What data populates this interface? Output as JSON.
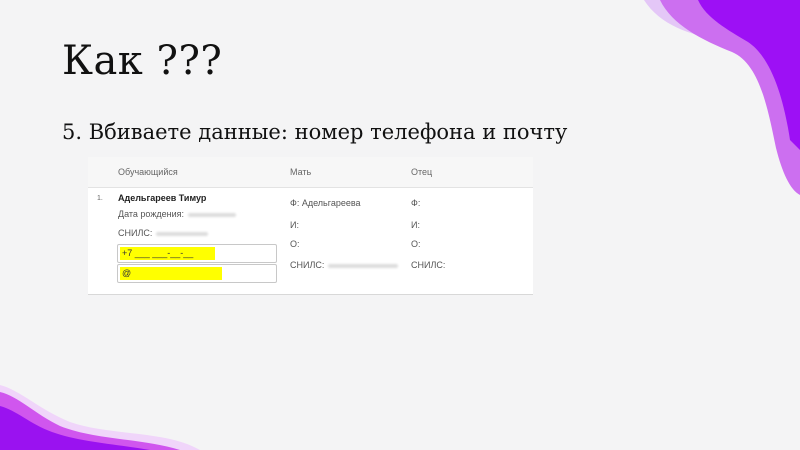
{
  "slide": {
    "title": "Как ???",
    "subtitle": "5. Вбиваете данные: номер телефона и почту"
  },
  "table": {
    "headers": {
      "student": "Обучающийся",
      "mother": "Мать",
      "father": "Отец"
    },
    "row": {
      "number": "1.",
      "student": {
        "name": "Адельгареев Тимур",
        "birth_label": "Дата рождения:",
        "snils_label": "СНИЛС:",
        "phone_value": "+7 ___ ___-__-__",
        "email_value": "@"
      },
      "mother": {
        "f_label": "Ф: Адельгареева",
        "i_label": "И:",
        "o_label": "О:",
        "snils_label": "СНИЛС:"
      },
      "father": {
        "f_label": "Ф:",
        "i_label": "И:",
        "o_label": "О:",
        "snils_label": "СНИЛС:"
      }
    }
  },
  "colors": {
    "highlight": "#ffff00",
    "accent_purple": "#a100ff",
    "accent_magenta": "#d81cf0"
  }
}
